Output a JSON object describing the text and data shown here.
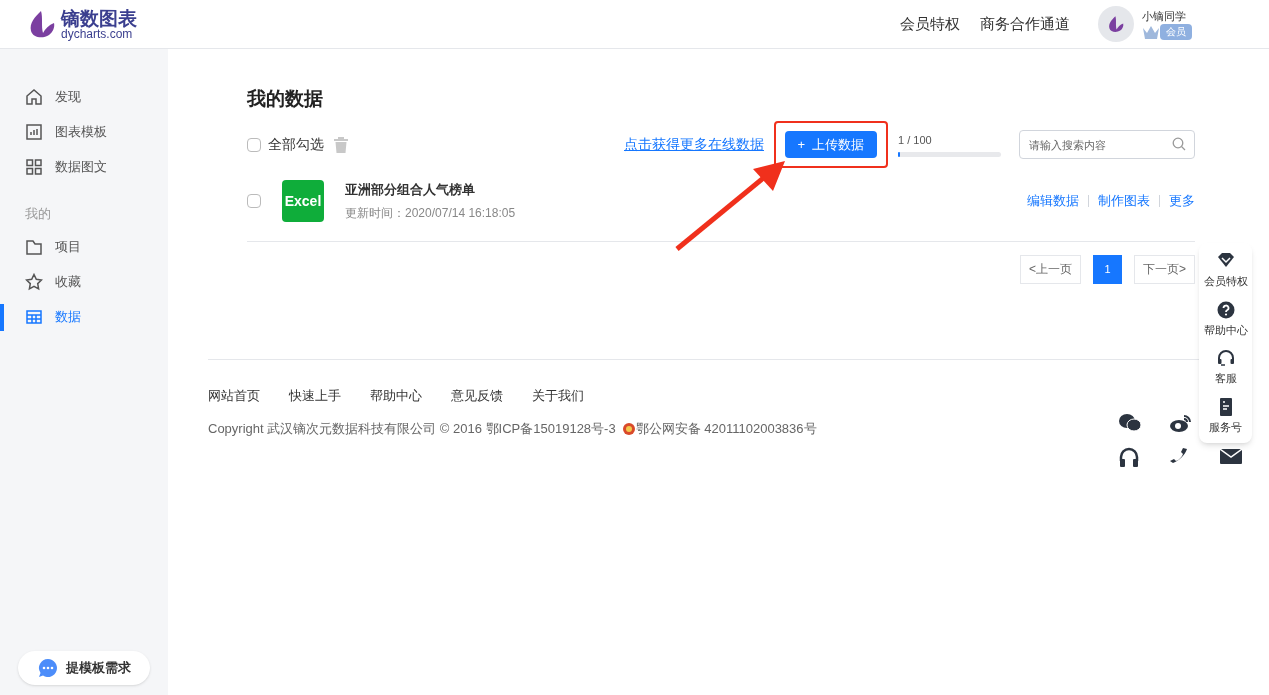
{
  "header": {
    "logo_title": "镝数图表",
    "logo_subtitle": "dycharts.com",
    "nav": [
      "会员特权",
      "商务合作通道"
    ],
    "user": {
      "name": "小镝同学",
      "badge": "会员"
    }
  },
  "sidebar": {
    "items": [
      {
        "label": "发现",
        "selected": false
      },
      {
        "label": "图表模板",
        "selected": false
      },
      {
        "label": "数据图文",
        "selected": false
      }
    ],
    "section_label": "我的",
    "my_items": [
      {
        "label": "项目",
        "selected": false
      },
      {
        "label": "收藏",
        "selected": false
      },
      {
        "label": "数据",
        "selected": true
      }
    ],
    "request_button": "提模板需求"
  },
  "main": {
    "title": "我的数据",
    "select_all": {
      "label": "全部勾选",
      "checked": false
    },
    "more_data_link": "点击获得更多在线数据",
    "upload_button": "+  上传数据",
    "quota": {
      "text": "1 / 100",
      "level": 0.01
    },
    "search": {
      "placeholder": "请输入搜索内容"
    },
    "files": [
      {
        "name": "亚洲部分组合人气榜单",
        "badge": "Excel",
        "updated": "更新时间：2020/07/14 16:18:05",
        "checked": false,
        "actions": [
          "编辑数据",
          "制作图表",
          "更多"
        ]
      }
    ],
    "pagination": {
      "prev": "<上一页",
      "pages": [
        {
          "label": "1",
          "selected": true
        }
      ],
      "next": "下一页>"
    }
  },
  "footer": {
    "links": [
      "网站首页",
      "快速上手",
      "帮助中心",
      "意见反馈",
      "关于我们"
    ],
    "copyright": "Copyright 武汉镝次元数据科技有限公司 © 2016 鄂ICP备15019128号-3",
    "police": "鄂公网安备 42011102003836号"
  },
  "float_panel": [
    {
      "label": "会员特权"
    },
    {
      "label": "帮助中心"
    },
    {
      "label": "客服"
    },
    {
      "label": "服务号"
    }
  ]
}
